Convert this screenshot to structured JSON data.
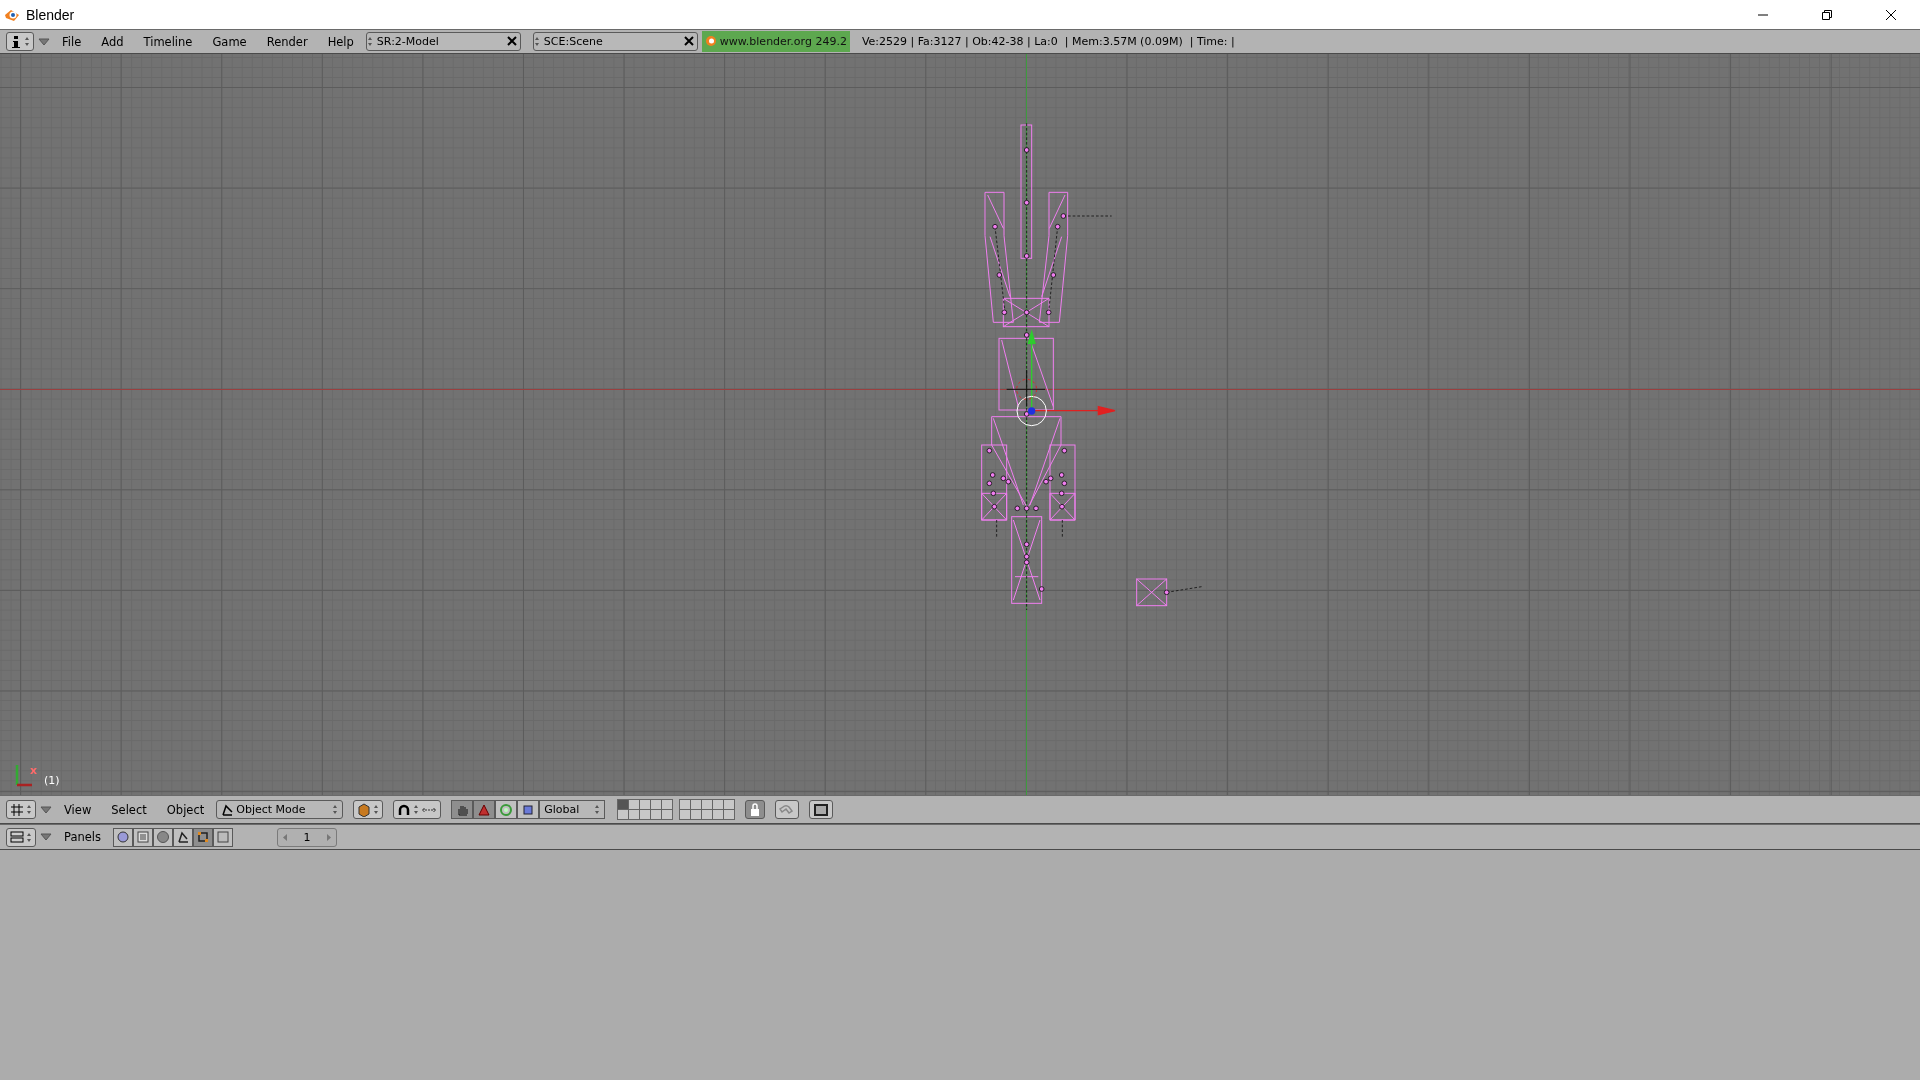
{
  "window": {
    "title": "Blender"
  },
  "info_header": {
    "menus": [
      "File",
      "Add",
      "Timeline",
      "Game",
      "Render",
      "Help"
    ],
    "screen": "SR:2-Model",
    "scene": "SCE:Scene",
    "version": "www.blender.org 249.2",
    "stats": "Ve:2529 | Fa:3127 | Ob:42-38 | La:0  | Mem:3.57M (0.09M)  | Time: |"
  },
  "viewport": {
    "axis_label": "x",
    "frame": "(1)"
  },
  "view3d_header": {
    "menus": [
      "View",
      "Select",
      "Object"
    ],
    "mode": "Object Mode",
    "orientation": "Global",
    "manipulators": [
      {
        "kind": "hand",
        "selected": true
      },
      {
        "kind": "translate",
        "selected": true
      },
      {
        "kind": "rotate",
        "selected": false
      },
      {
        "kind": "scale",
        "selected": false
      }
    ],
    "layers": [
      {
        "selected": true
      },
      {
        "selected": false
      },
      {
        "selected": false
      },
      {
        "selected": false
      },
      {
        "selected": false
      },
      {
        "selected": false
      },
      {
        "selected": false
      },
      {
        "selected": false
      },
      {
        "selected": false
      },
      {
        "selected": false
      },
      {
        "selected": false
      },
      {
        "selected": false
      },
      {
        "selected": false
      },
      {
        "selected": false
      },
      {
        "selected": false
      },
      {
        "selected": false
      },
      {
        "selected": false
      },
      {
        "selected": false
      },
      {
        "selected": false
      },
      {
        "selected": false
      }
    ]
  },
  "buttons_header": {
    "label": "Panels",
    "contexts": [
      {
        "kind": "logic",
        "selected": false
      },
      {
        "kind": "script",
        "selected": false
      },
      {
        "kind": "shading",
        "selected": false
      },
      {
        "kind": "object",
        "selected": false
      },
      {
        "kind": "editing",
        "selected": true
      },
      {
        "kind": "scene",
        "selected": false
      }
    ],
    "frame": "1"
  }
}
